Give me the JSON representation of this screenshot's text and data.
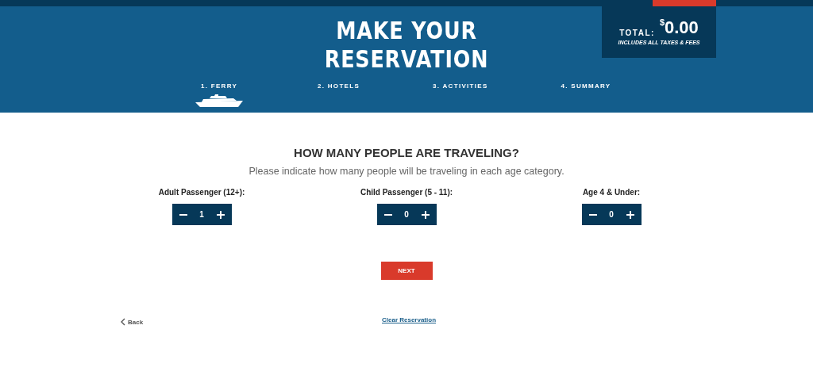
{
  "header": {
    "title_lines": [
      "MAKE YOUR",
      "RESERVATION"
    ],
    "total": {
      "label": "TOTAL:",
      "currency": "$",
      "amount": "0.00",
      "note": "INCLUDES ALL TAXES & FEES"
    }
  },
  "steps": [
    {
      "label": "1. FERRY",
      "selected": true
    },
    {
      "label": "2. HOTELS",
      "selected": false
    },
    {
      "label": "3. ACTIVITIES",
      "selected": false
    },
    {
      "label": "4. SUMMARY",
      "selected": false
    }
  ],
  "heading": "HOW MANY PEOPLE ARE TRAVELING?",
  "subheading": "Please indicate how many people will be traveling in each age category.",
  "passengers": [
    {
      "label": "Adult Passenger (12+):",
      "value": "1"
    },
    {
      "label": "Child Passenger (5 - 11):",
      "value": "0"
    },
    {
      "label": "Age 4 & Under:",
      "value": "0"
    }
  ],
  "next_button": "NEXT",
  "back_link": "Back",
  "clear_link": "Clear Reservation"
}
